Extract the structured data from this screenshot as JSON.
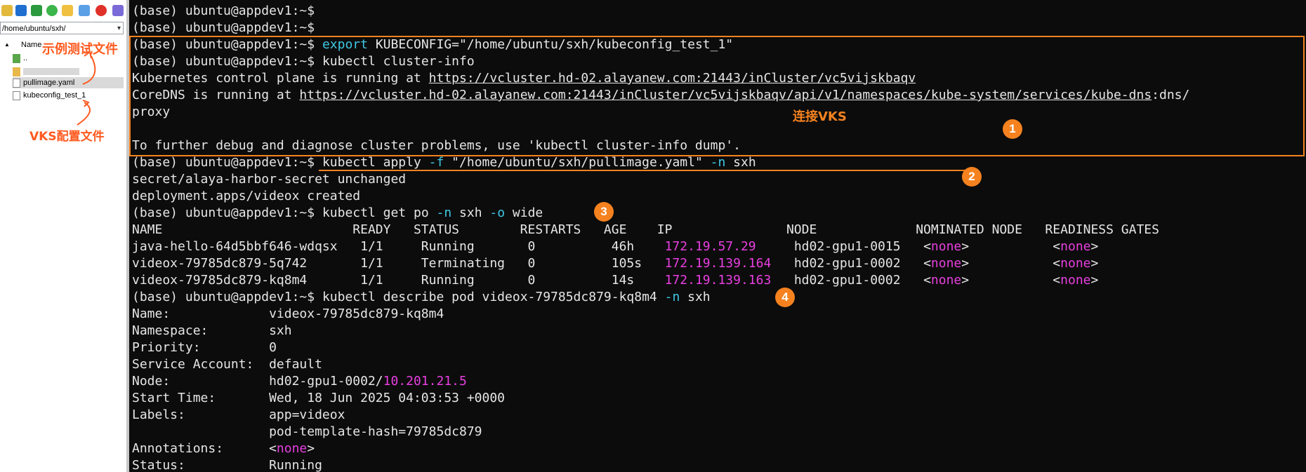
{
  "file_panel": {
    "path": "/home/ubuntu/sxh/",
    "column_header": "Name",
    "files": [
      "..",
      "pullimage.yaml",
      "kubeconfig_test_1"
    ],
    "annotation_sample": "示例测试文件",
    "annotation_config": "VKS配置文件"
  },
  "terminal": {
    "prompt": "(base) ubuntu@appdev1:~$",
    "cmd_export_kw": "export",
    "cmd_export_rest": "KUBECONFIG=\"/home/ubuntu/sxh/kubeconfig_test_1\"",
    "cmd_cluster_info": "kubectl cluster-info",
    "k8s_prefix": "Kubernetes control plane is running at ",
    "k8s_url": "https://vcluster.hd-02.alayanew.com:21443/inCluster/vc5vijskbaqv",
    "coredns_prefix": "CoreDNS is running at ",
    "coredns_url": "https://vcluster.hd-02.alayanew.com:21443/inCluster/vc5vijskbaqv/api/v1/namespaces/kube-system/services/kube-dns",
    "coredns_suffix": ":dns/",
    "coredns_wrap": "proxy",
    "debug_hint": "To further debug and diagnose cluster problems, use 'kubectl cluster-info dump'.",
    "connect_label": "连接VKS",
    "apply_a": "kubectl apply ",
    "apply_f": "-f",
    "apply_b": " \"/home/ubuntu/sxh/pullimage.yaml\" ",
    "apply_n": "-n",
    "apply_c": " sxh",
    "apply_out1": "secret/alaya-harbor-secret unchanged",
    "apply_out2": "deployment.apps/videox created",
    "getpo_a": "kubectl get po ",
    "getpo_n": "-n",
    "getpo_b": " sxh ",
    "getpo_o": "-o",
    "getpo_c": " wide",
    "pods_header": "NAME                         READY   STATUS        RESTARTS   AGE    IP               NODE             NOMINATED NODE   READINESS GATES",
    "pods": [
      {
        "left": "java-hello-64d5bbf646-wdqsx   1/1     Running       0          46h    ",
        "ip": "172.19.57.29    ",
        "node": " hd02-gpu1-0015   "
      },
      {
        "left": "videox-79785dc879-5q742       1/1     Terminating   0          105s   ",
        "ip": "172.19.139.164  ",
        "node": " hd02-gpu1-0002   "
      },
      {
        "left": "videox-79785dc879-kq8m4       1/1     Running       0          14s    ",
        "ip": "172.19.139.163  ",
        "node": " hd02-gpu1-0002   "
      }
    ],
    "none_word": "none",
    "describe_a": "kubectl describe pod videox-79785dc879-kq8m4 ",
    "describe_n": "-n",
    "describe_b": " sxh",
    "desc_name": "Name:             videox-79785dc879-kq8m4",
    "desc_namespace": "Namespace:        sxh",
    "desc_priority": "Priority:         0",
    "desc_sa": "Service Account:  default",
    "desc_node_a": "Node:             hd02-gpu1-0002/",
    "desc_node_ip": "10.201.21.5",
    "desc_start": "Start Time:       Wed, 18 Jun 2025 04:03:53 +0000",
    "desc_labels1": "Labels:           app=videox",
    "desc_labels2": "                  pod-template-hash=79785dc879",
    "desc_ann_a": "Annotations:      <",
    "desc_status": "Status:           Running",
    "markers": [
      "1",
      "2",
      "3",
      "4"
    ]
  },
  "colors": {
    "accent": "#f5821f",
    "cyan": "#3fc8e4",
    "magenta": "#e83fe0",
    "terminal_bg": "#0c0c0c"
  }
}
